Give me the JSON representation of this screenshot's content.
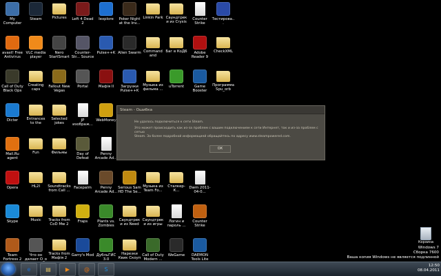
{
  "desktop": {
    "icons": [
      {
        "label": "My Computer",
        "kind": "app",
        "color": "#3c6ea8"
      },
      {
        "label": "Steam",
        "kind": "app",
        "color": "#1b2838"
      },
      {
        "label": "Pictures",
        "kind": "folder",
        "color": "#e0c060"
      },
      {
        "label": "Left 4 Dead 2",
        "kind": "app",
        "color": "#7a1a1a"
      },
      {
        "label": "Iexplore",
        "kind": "app",
        "color": "#1d6fd0"
      },
      {
        "label": "Poker Night at the Inv...",
        "kind": "app",
        "color": "#3a2a1a"
      },
      {
        "label": "Linkin Park",
        "kind": "folder",
        "color": "#e0c060"
      },
      {
        "label": "Саундтреки из Crysis 2",
        "kind": "folder",
        "color": "#e0c060"
      },
      {
        "label": "Counter Strike Source",
        "kind": "doc",
        "color": "#ffffff"
      },
      {
        "label": "Тестирова... отчетности",
        "kind": "app",
        "color": "#2a4aa8"
      },
      {
        "label": "avast! Free Antivirus",
        "kind": "app",
        "color": "#e06a10"
      },
      {
        "label": "VLC media player",
        "kind": "app",
        "color": "#f08a1a"
      },
      {
        "label": "Nero StartSmart",
        "kind": "app",
        "color": "#444"
      },
      {
        "label": "Counter-Str... Source",
        "kind": "app",
        "color": "#556"
      },
      {
        "label": "Pulse++K",
        "kind": "app",
        "color": "#2a5ab0"
      },
      {
        "label": "Alien Swarm",
        "kind": "app",
        "color": "#2a2a2a"
      },
      {
        "label": "Command and Conqu...",
        "kind": "folder",
        "color": "#e0c060"
      },
      {
        "label": "Баг в КоД6",
        "kind": "folder",
        "color": "#e0c060"
      },
      {
        "label": "Adobe Reader 9",
        "kind": "app",
        "color": "#b01010"
      },
      {
        "label": "CheckXML",
        "kind": "folder",
        "color": "#e0c060"
      },
      {
        "label": "Call of Duty Black Ops",
        "kind": "app",
        "color": "#3a3a2a"
      },
      {
        "label": "Creating caps",
        "kind": "folder",
        "color": "#e0c060"
      },
      {
        "label": "Fallout New Vegas",
        "kind": "app",
        "color": "#8a6a1a"
      },
      {
        "label": "Portal",
        "kind": "app",
        "color": "#555"
      },
      {
        "label": "Мафія II",
        "kind": "app",
        "color": "#8a1010"
      },
      {
        "label": "Загрузки Pulse++K",
        "kind": "app",
        "color": "#2a5ab0"
      },
      {
        "label": "Музыка из фильма ...",
        "kind": "folder",
        "color": "#e0c060"
      },
      {
        "label": "uTorrent",
        "kind": "app",
        "color": "#3a9a2a"
      },
      {
        "label": "Game Booster",
        "kind": "app",
        "color": "#1a5aa0"
      },
      {
        "label": "Программа Spu_orb",
        "kind": "folder",
        "color": "#e0c060"
      },
      {
        "label": "Dicter",
        "kind": "app",
        "color": "#1a7ad0"
      },
      {
        "label": "Entrances to the Prestige",
        "kind": "folder",
        "color": "#e0c060"
      },
      {
        "label": "Selected jokes",
        "kind": "folder",
        "color": "#e0c060"
      },
      {
        "label": "JP изображ...",
        "kind": "doc",
        "color": "#ffffff"
      },
      {
        "label": "WebMoney",
        "kind": "app",
        "color": "#d0a010"
      },
      {
        "label": "",
        "kind": "none",
        "color": ""
      },
      {
        "label": "",
        "kind": "none",
        "color": ""
      },
      {
        "label": "",
        "kind": "none",
        "color": ""
      },
      {
        "label": "",
        "kind": "none",
        "color": ""
      },
      {
        "label": "",
        "kind": "none",
        "color": ""
      },
      {
        "label": "Mail.Ru agent",
        "kind": "app",
        "color": "#e07010"
      },
      {
        "label": "Fun",
        "kind": "folder",
        "color": "#e0c060"
      },
      {
        "label": "Фильмы",
        "kind": "folder",
        "color": "#e0c060"
      },
      {
        "label": "Day of Defeat Source",
        "kind": "app",
        "color": "#5a5a3a"
      },
      {
        "label": "Penny Arcade Ad...",
        "kind": "doc",
        "color": "#ffffff"
      },
      {
        "label": "",
        "kind": "none",
        "color": ""
      },
      {
        "label": "",
        "kind": "none",
        "color": ""
      },
      {
        "label": "",
        "kind": "none",
        "color": ""
      },
      {
        "label": "",
        "kind": "none",
        "color": ""
      },
      {
        "label": "",
        "kind": "none",
        "color": ""
      },
      {
        "label": "Opera",
        "kind": "app",
        "color": "#c01010"
      },
      {
        "label": "HL2I",
        "kind": "folder",
        "color": "#e0c060"
      },
      {
        "label": "Soundtracks from Call ...",
        "kind": "folder",
        "color": "#e0c060"
      },
      {
        "label": "Facepalm",
        "kind": "doc",
        "color": "#ffffff"
      },
      {
        "label": "Penny Arcade Ad...",
        "kind": "app",
        "color": "#6a4a2a"
      },
      {
        "label": "Serious Sam HD The Se...",
        "kind": "app",
        "color": "#c08a10"
      },
      {
        "label": "Музыка из Team Fo...",
        "kind": "folder",
        "color": "#e0c060"
      },
      {
        "label": "Сталкер-К...",
        "kind": "folder",
        "color": "#e0c060"
      },
      {
        "label": "Dwm 2011-04-0...",
        "kind": "doc",
        "color": "#ffffff"
      },
      {
        "label": "",
        "kind": "none",
        "color": ""
      },
      {
        "label": "Skype",
        "kind": "app",
        "color": "#1a8ad8"
      },
      {
        "label": "Music",
        "kind": "folder",
        "color": "#e0c060"
      },
      {
        "label": "Tracks from CoD Mw 2",
        "kind": "folder",
        "color": "#e0c060"
      },
      {
        "label": "Fraps",
        "kind": "app",
        "color": "#d0b010"
      },
      {
        "label": "Plants vs. Zombies",
        "kind": "app",
        "color": "#3a8a2a"
      },
      {
        "label": "Саундтреки из Need F...",
        "kind": "folder",
        "color": "#e0c060"
      },
      {
        "label": "Саундтреки из игры Co...",
        "kind": "folder",
        "color": "#e0c060"
      },
      {
        "label": "Логин и пароль ...",
        "kind": "doc",
        "color": "#ffffff"
      },
      {
        "label": "Counter Strike Sour...",
        "kind": "app",
        "color": "#c06010"
      },
      {
        "label": "",
        "kind": "none",
        "color": ""
      },
      {
        "label": "Team Fortress 2",
        "kind": "app",
        "color": "#b05a1a"
      },
      {
        "label": "Что он делает О_о",
        "kind": "app",
        "color": "#555"
      },
      {
        "label": "Tracks from Мафія 2",
        "kind": "folder",
        "color": "#e0c060"
      },
      {
        "label": "Garry's Mod",
        "kind": "app",
        "color": "#1a4a9a"
      },
      {
        "label": "ДубльГИС 3.0",
        "kind": "app",
        "color": "#3a8a2a"
      },
      {
        "label": "Нарезки Квик Скоуп",
        "kind": "folder",
        "color": "#e0c060"
      },
      {
        "label": "Call of Duty Modern ...",
        "kind": "app",
        "color": "#3a6a2a"
      },
      {
        "label": "WeGame",
        "kind": "app",
        "color": "#2a2a2a"
      },
      {
        "label": "DAEMON Tools Lite",
        "kind": "app",
        "color": "#1a5aa0"
      },
      {
        "label": "",
        "kind": "none",
        "color": ""
      }
    ]
  },
  "dialog": {
    "title": "Steam - Ошибка",
    "line1": "Не удалось подключиться к сети Steam.",
    "line2": "Это может происходить как из-за проблем с вашим подключением к сети Интернет, так и из-за проблем с сетью",
    "line3": "Steam. За более подробной информацией обращайтесь по адресу www.steampowered.com.",
    "ok_label": "ОК"
  },
  "recycle_bin": {
    "label": "Корзина"
  },
  "watermark": {
    "line1": "Windows 7",
    "line2": "Сборка 7600",
    "line3": "Ваша копия Windows не является подлинной"
  },
  "taskbar": {
    "pinned": [
      {
        "name": "ie-icon",
        "glyph": "e",
        "color": "#1d6fd0"
      },
      {
        "name": "explorer-icon",
        "glyph": "▤",
        "color": "#e0c060"
      },
      {
        "name": "media-player-icon",
        "glyph": "▶",
        "color": "#f08a1a"
      },
      {
        "name": "mail-ru-agent-icon",
        "glyph": "@",
        "color": "#e07010"
      },
      {
        "name": "skype-icon",
        "glyph": "S",
        "color": "#1a8ad8"
      }
    ],
    "clock_time": "12:50",
    "clock_date": "08.04.2011"
  }
}
